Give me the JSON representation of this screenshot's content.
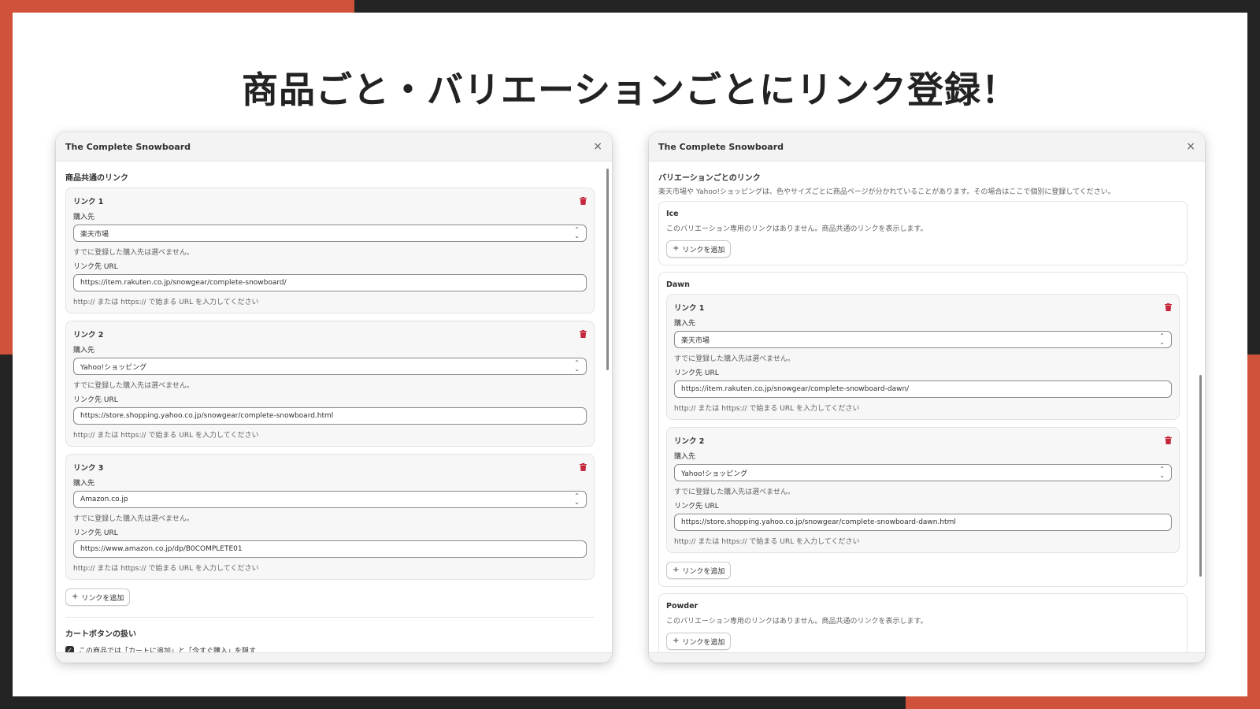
{
  "slide": {
    "title": "商品ごと・バリエーションごとにリンク登録！"
  },
  "colors": {
    "accent": "#d0523a",
    "frame": "#242424",
    "danger": "#c5283d"
  },
  "common": {
    "label_link_prefix": "リンク",
    "label_vendor": "購入先",
    "label_url": "リンク先 URL",
    "vendor_help": "すでに登録した購入先は選べません。",
    "url_help": "http:// または https:// で始まる URL を入力してください",
    "add_link": "リンクを追加",
    "plus": "+"
  },
  "left_modal": {
    "title": "The Complete Snowboard",
    "close": "×",
    "section_title": "商品共通のリンク",
    "links": [
      {
        "title": "リンク 1",
        "vendor": "楽天市場",
        "url": "https://item.rakuten.co.jp/snowgear/complete-snowboard/"
      },
      {
        "title": "リンク 2",
        "vendor": "Yahoo!ショッピング",
        "url": "https://store.shopping.yahoo.co.jp/snowgear/complete-snowboard.html"
      },
      {
        "title": "リンク 3",
        "vendor": "Amazon.co.jp",
        "url": "https://www.amazon.co.jp/dp/B0COMPLETE01"
      }
    ],
    "cart_section_title": "カートボタンの扱い",
    "cart_checkbox_label": "この商品では「カートに追加」と「今すぐ購入」を隠す",
    "cart_checkbox_checked": true
  },
  "right_modal": {
    "title": "The Complete Snowboard",
    "close": "×",
    "section_title": "バリエーションごとのリンク",
    "section_desc": "楽天市場や Yahoo!ショッピングは、色やサイズごとに商品ページが分かれていることがあります。その場合はここで個別に登録してください。",
    "no_links_note": "このバリエーション専用のリンクはありません。商品共通のリンクを表示します。",
    "variants": [
      {
        "name": "Ice"
      },
      {
        "name": "Dawn",
        "links": [
          {
            "title": "リンク 1",
            "vendor": "楽天市場",
            "url": "https://item.rakuten.co.jp/snowgear/complete-snowboard-dawn/"
          },
          {
            "title": "リンク 2",
            "vendor": "Yahoo!ショッピング",
            "url": "https://store.shopping.yahoo.co.jp/snowgear/complete-snowboard-dawn.html"
          }
        ]
      },
      {
        "name": "Powder"
      }
    ]
  }
}
